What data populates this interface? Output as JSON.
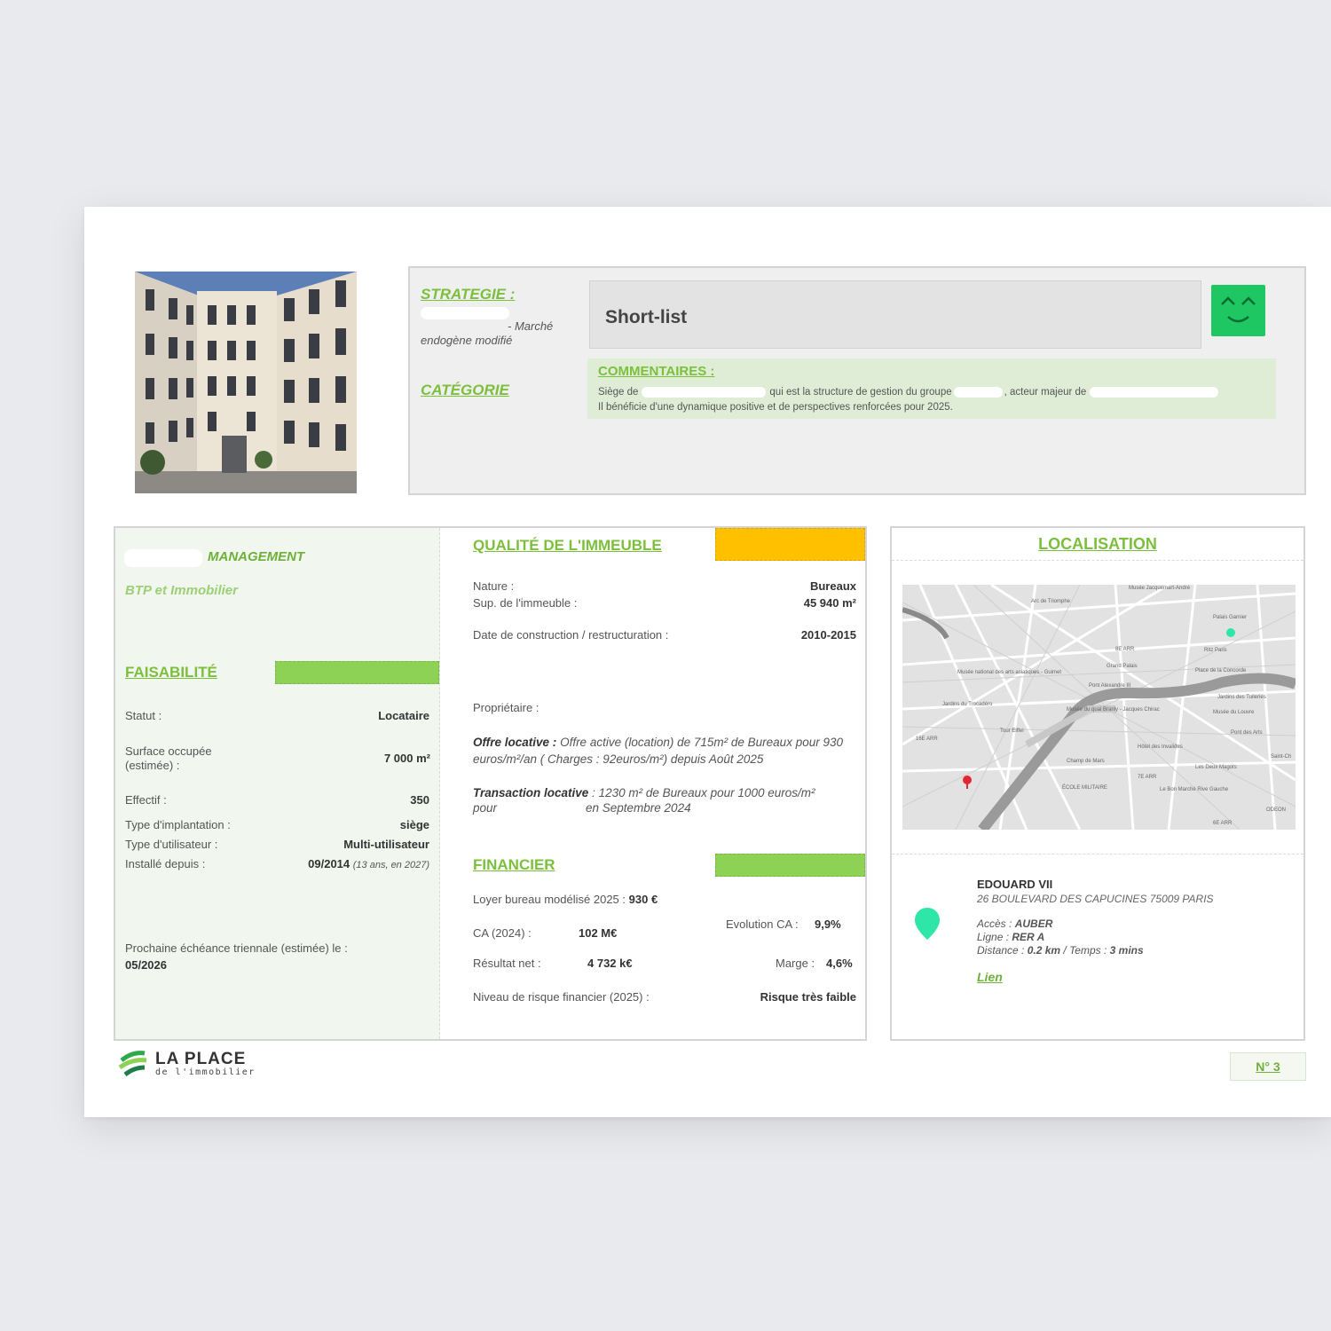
{
  "strategy": {
    "label": "STRATEGIE :",
    "text_line1": "- Marché",
    "text_line2": "endogène modifié",
    "category_label": "CATÉGORIE",
    "status": "Short-list",
    "comments_label": "COMMENTAIRES :",
    "comment_part1": "Siège de",
    "comment_part2": "qui est la structure de gestion du groupe",
    "comment_part3": ", acteur majeur de",
    "comment_line2": "Il bénéficie d'une dynamique positive et de perspectives renforcées pour 2025.",
    "smiley_color": "#1ec761"
  },
  "company": {
    "name_suffix": "MANAGEMENT",
    "sector": "BTP et Immobilier"
  },
  "feasibility": {
    "title": "FAISABILITÉ",
    "bar_color": "#8dd155",
    "statut_label": "Statut :",
    "statut_value": "Locataire",
    "surface_label_1": "Surface occupée",
    "surface_label_2": "(estimée) :",
    "surface_value": "7 000 m²",
    "effectif_label": "Effectif :",
    "effectif_value": "350",
    "type_impl_label": "Type d'implantation :",
    "type_impl_value": "siège",
    "type_user_label": "Type d'utilisateur :",
    "type_user_value": "Multi-utilisateur",
    "installe_label": "Installé depuis :",
    "installe_value": "09/2014",
    "installe_note": "(13 ans, en 2027)",
    "echeance_label": "Prochaine échéance triennale (estimée) le :",
    "echeance_value": "05/2026"
  },
  "quality": {
    "title": "QUALITÉ DE L'IMMEUBLE",
    "bar_color": "#ffc000",
    "nature_label": "Nature :",
    "nature_value": "Bureaux",
    "sup_label": "Sup. de l'immeuble :",
    "sup_value": "45 940 m²",
    "date_label": "Date de construction / restructuration :",
    "date_value": "2010-2015",
    "owner_label": "Propriétaire :",
    "offre_label": "Offre locative :",
    "offre_text": "Offre active (location) de 715m² de Bureaux pour 930 euros/m²/an  ( Charges : 92euros/m²) depuis Août 2025",
    "transaction_label": "Transaction locative",
    "transaction_text": ": 1230 m² de Bureaux pour 1000 euros/m²",
    "transaction_line2a": "pour",
    "transaction_line2b": "en Septembre 2024"
  },
  "financial": {
    "title": "FINANCIER",
    "bar_color": "#8dd155",
    "loyer_label": "Loyer bureau modélisé 2025 :",
    "loyer_value": "930 €",
    "evolution_label": "Evolution CA :",
    "evolution_value": "9,9%",
    "ca_label": "CA (2024) :",
    "ca_value": "102  M€",
    "resultat_label": "Résultat net :",
    "resultat_value": "4 732  k€",
    "marge_label": "Marge :",
    "marge_value": "4,6%",
    "risque_label": "Niveau de risque financier (2025) :",
    "risque_value": "Risque très faible"
  },
  "location": {
    "title": "LOCALISATION",
    "building": "EDOUARD VII",
    "address": "26  BOULEVARD DES CAPUCINES 75009 PARIS",
    "acces_label": "Accès :",
    "acces_value": "AUBER",
    "ligne_label": "Ligne :",
    "ligne_value": "RER A",
    "distance_label": "Distance :",
    "distance_value": "0.2 km",
    "temps_label": "/ Temps :",
    "temps_value": "3 mins",
    "link": "Lien",
    "pin_color": "#2ee6a8",
    "map_labels": [
      "Arc de Triomphe",
      "Musée Jacquemart-André",
      "Palais Garnier",
      "Ritz Paris",
      "8E ARR",
      "Grand Palais",
      "Place de la Concorde",
      "Musée national des arts asiatiques - Guimet",
      "Pont Alexandre III",
      "Jardins des Tuileries",
      "Jardins du Trocadéro",
      "Musée du quai Branly - Jacques Chirac",
      "Musée du Louvre",
      "16E ARR",
      "Tour Eiffel",
      "Hôtel des Invalides",
      "Pont des Arts",
      "Champ de Mars",
      "7E ARR",
      "Les Deux Magots",
      "ÉCOLE MILITAIRE",
      "Le Bon Marché Rive Gauche",
      "ODEON",
      "6E ARR",
      "Saint-Ch"
    ]
  },
  "footer": {
    "logo_main": "LA PLACE",
    "logo_sub": "de l'immobilier",
    "page_number": "N° 3"
  }
}
